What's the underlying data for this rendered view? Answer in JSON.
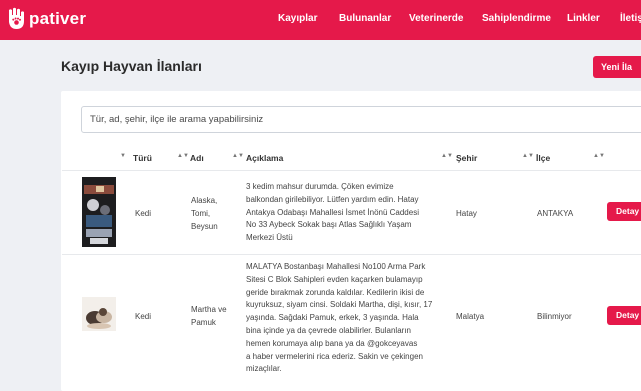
{
  "brand": {
    "name": "pativer"
  },
  "nav": {
    "items": [
      "Kayıplar",
      "Bulunanlar",
      "Veterinerde",
      "Sahiplendirme",
      "Linkler",
      "İletişi"
    ]
  },
  "page": {
    "title": "Kayıp Hayvan İlanları",
    "new_button": "Yeni İla"
  },
  "search": {
    "placeholder": "Tür, ad, şehir, ilçe ile arama yapabilirsiniz"
  },
  "table": {
    "headers": [
      "Türü",
      "Adı",
      "Açıklama",
      "Şehir",
      "İlçe"
    ],
    "rows": [
      {
        "type": "Kedi",
        "name": "Alaska,\nTomi,\nBeysun",
        "description": "3 kedim mahsur durumda. Çöken evimize\nbalkondan girilebiliyor. Lütfen yardım edin. Hatay\nAntakya Odabaşı Mahallesi İsmet İnönü Caddesi\nNo 33 Aybeck Sokak başı Atlas Sağlıklı Yaşam\nMerkezi Üstü",
        "city": "Hatay",
        "district": "ANTAKYA",
        "action": "Detay"
      },
      {
        "type": "Kedi",
        "name": "Martha ve\nPamuk",
        "description": "MALATYA Bostanbaşı Mahallesi No100 Arma Park\nSitesi C Blok Sahipleri evden kaçarken bulamayıp\ngeride bırakmak zorunda kaldılar. Kedilerin ikisi de\nkuyruksuz, siyam cinsi. Soldaki Martha, dişi, kısır, 17\nyaşında. Sağdaki Pamuk, erkek, 3 yaşında. Hala\nbina içinde ya da çevrede olabilirler. Bulanların\nhemen korumaya alıp bana ya da @gokceyavas\na haber vermelerini rica ederiz. Sakin ve çekingen\nmizaçlılar.",
        "city": "Malatya",
        "district": "Bilinmiyor",
        "action": "Detay"
      }
    ]
  }
}
